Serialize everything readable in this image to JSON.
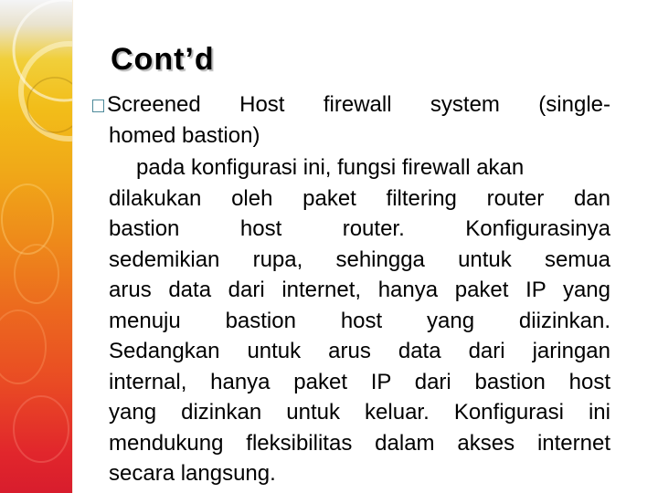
{
  "slide": {
    "title": "Cont’d",
    "bullet": {
      "icon": "hollow-square-bullet-icon",
      "line1": "Screened Host firewall system (single-",
      "line2": "homed bastion)"
    },
    "paragraph": {
      "lines": [
        "pada konfigurasi ini, fungsi firewall akan",
        "dilakukan  oleh paket filtering router dan",
        "bastion host router. Konfigurasinya",
        "sedemikian rupa, sehingga untuk semua",
        "arus data dari internet, hanya paket IP yang",
        "menuju bastion host yang diizinkan.",
        "Sedangkan untuk arus data dari jaringan",
        "internal, hanya paket IP dari bastion host",
        "yang dizinkan untuk keluar. Konfigurasi ini",
        "mendukung fleksibilitas dalam akses internet",
        "secara langsung."
      ]
    },
    "colors": {
      "bullet_border": "#4e8a9a",
      "strip_top": "#f1cf3a",
      "strip_middle": "#ee8c1a",
      "strip_bottom": "#d81d2d"
    }
  }
}
